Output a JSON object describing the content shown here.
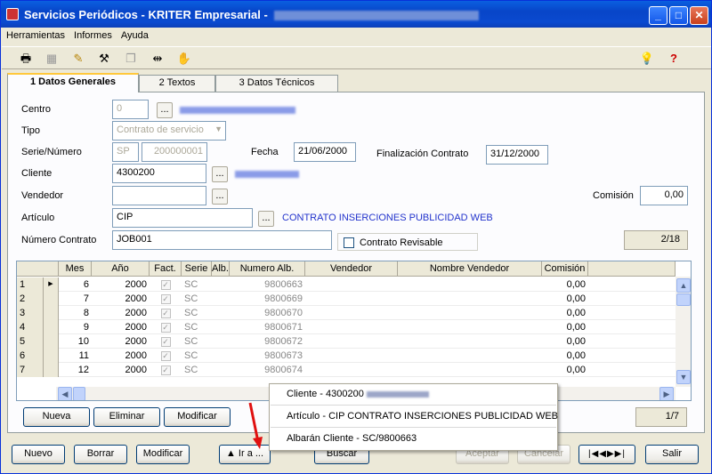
{
  "window": {
    "title": "Servicios Periódicos - KRITER Empresarial - ",
    "minimize": "_",
    "maximize": "□",
    "close": "✕"
  },
  "menu": [
    "Herramientas",
    "Informes",
    "Ayuda"
  ],
  "toolbar_icons": [
    "printer-icon",
    "table-icon",
    "pen-icon",
    "hammer-icon",
    "copy-icon",
    "split-icon",
    "hand-icon",
    "lightbulb-icon",
    "help-icon"
  ],
  "tabs": [
    "1 Datos Generales",
    "2 Textos",
    "3 Datos Técnicos"
  ],
  "form": {
    "centro_label": "Centro",
    "centro_value": "0",
    "tipo_label": "Tipo",
    "tipo_value": "Contrato de servicio",
    "serie_label": "Serie/Número",
    "serie_value": "SP",
    "numero_value": "200000001",
    "fecha_label": "Fecha",
    "fecha_value": "21/06/2000",
    "finalizacion_label": "Finalización Contrato",
    "finalizacion_value": "31/12/2000",
    "cliente_label": "Cliente",
    "cliente_value": "4300200",
    "vendedor_label": "Vendedor",
    "vendedor_value": "",
    "comision_label": "Comisión",
    "comision_value": "0,00",
    "articulo_label": "Artículo",
    "articulo_value": "CIP",
    "articulo_desc": "CONTRATO INSERCIONES PUBLICIDAD WEB",
    "numero_contrato_label": "Número Contrato",
    "numero_contrato_value": "JOB001",
    "contrato_revisable_label": "Contrato Revisable",
    "record_counter": "2/18",
    "dots": "..."
  },
  "grid": {
    "headers": [
      "Mes",
      "Año",
      "Fact.",
      "Serie",
      "Alb.",
      "Numero Alb.",
      "Vendedor",
      "Nombre Vendedor",
      "Comisión"
    ],
    "rows": [
      {
        "n": "1",
        "mes": "6",
        "anio": "2000",
        "serie": "SC",
        "num": "9800663",
        "com": "0,00"
      },
      {
        "n": "2",
        "mes": "7",
        "anio": "2000",
        "serie": "SC",
        "num": "9800669",
        "com": "0,00"
      },
      {
        "n": "3",
        "mes": "8",
        "anio": "2000",
        "serie": "SC",
        "num": "9800670",
        "com": "0,00"
      },
      {
        "n": "4",
        "mes": "9",
        "anio": "2000",
        "serie": "SC",
        "num": "9800671",
        "com": "0,00"
      },
      {
        "n": "5",
        "mes": "10",
        "anio": "2000",
        "serie": "SC",
        "num": "9800672",
        "com": "0,00"
      },
      {
        "n": "6",
        "mes": "11",
        "anio": "2000",
        "serie": "SC",
        "num": "9800673",
        "com": "0,00"
      },
      {
        "n": "7",
        "mes": "12",
        "anio": "2000",
        "serie": "SC",
        "num": "9800674",
        "com": "0,00"
      }
    ],
    "counter": "1/7"
  },
  "grid_buttons": [
    "Nueva",
    "Eliminar",
    "Modificar"
  ],
  "popup": [
    "Cliente - 4300200 ",
    "Artículo - CIP CONTRATO INSERCIONES PUBLICIDAD WEB",
    "Albarán Cliente - SC/9800663"
  ],
  "bottom_buttons": {
    "nuevo": "Nuevo",
    "borrar": "Borrar",
    "modificar": "Modificar",
    "ir_a": "▲ Ir a ...",
    "buscar": "Buscar",
    "aceptar": "Aceptar",
    "cancelar": "Cancelar",
    "nav": "|◀◀▶▶|",
    "salir": "Salir"
  }
}
